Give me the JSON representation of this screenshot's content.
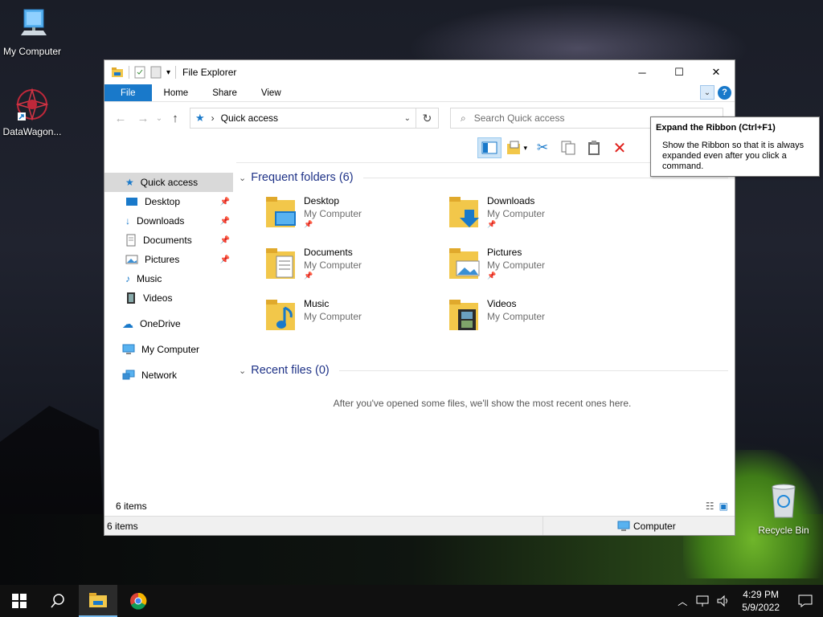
{
  "desktop": {
    "icons": [
      {
        "label": "My Computer"
      },
      {
        "label": "DataWagon..."
      },
      {
        "label": "Recycle Bin"
      }
    ]
  },
  "window": {
    "title": "File Explorer",
    "controls": {
      "minimize": "─",
      "maximize": "☐",
      "close": "✕"
    },
    "ribbon_tabs": [
      "File",
      "Home",
      "Share",
      "View"
    ],
    "nav": {
      "back": "←",
      "forward": "→",
      "recent": "⌄",
      "up": "↑"
    },
    "address": {
      "path": "Quick access"
    },
    "search": {
      "placeholder": "Search Quick access"
    },
    "nav_pane": [
      {
        "label": "Quick access"
      },
      {
        "label": "Desktop"
      },
      {
        "label": "Downloads"
      },
      {
        "label": "Documents"
      },
      {
        "label": "Pictures"
      },
      {
        "label": "Music"
      },
      {
        "label": "Videos"
      },
      {
        "label": "OneDrive"
      },
      {
        "label": "My Computer"
      },
      {
        "label": "Network"
      }
    ],
    "frequent": {
      "header": "Frequent folders (6)",
      "folders": [
        {
          "name": "Desktop",
          "location": "My Computer",
          "pinned": true
        },
        {
          "name": "Downloads",
          "location": "My Computer",
          "pinned": true
        },
        {
          "name": "Documents",
          "location": "My Computer",
          "pinned": true
        },
        {
          "name": "Pictures",
          "location": "My Computer",
          "pinned": true
        },
        {
          "name": "Music",
          "location": "My Computer",
          "pinned": false
        },
        {
          "name": "Videos",
          "location": "My Computer",
          "pinned": false
        }
      ]
    },
    "recent": {
      "header": "Recent files (0)",
      "empty_message": "After you've opened some files, we'll show the most recent ones here."
    },
    "status": {
      "items": "6 items",
      "bottom_items": "6 items",
      "location": "Computer"
    }
  },
  "tooltip": {
    "title": "Expand the Ribbon (Ctrl+F1)",
    "body": "Show the Ribbon so that it is always expanded even after you click a command."
  },
  "taskbar": {
    "time": "4:29 PM",
    "date": "5/9/2022"
  },
  "colors": {
    "accent": "#1979ca",
    "folder": "#f2c74a",
    "link": "#1e3287"
  }
}
